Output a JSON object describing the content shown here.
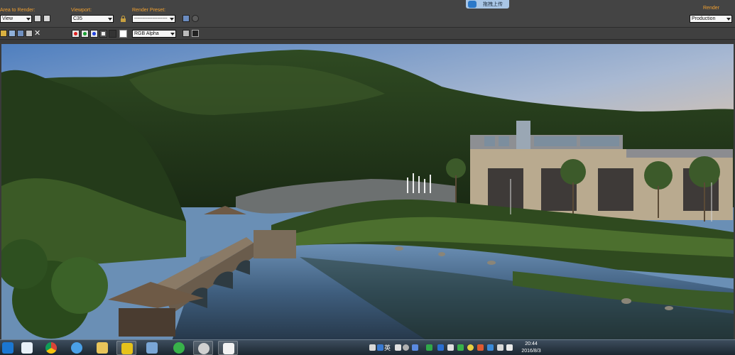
{
  "toolbar": {
    "area_label": "Area to Render:",
    "area_value": "View",
    "viewport_label": "Viewport:",
    "viewport_value": "C35",
    "preset_label": "Render Preset:",
    "preset_value": "--------------------",
    "render_label": "Render",
    "render_mode": "Production",
    "channel_value": "RGB Alpha"
  },
  "upload": {
    "label": "拖拽上传",
    "icon": "cloud-upload-icon"
  },
  "channels": {
    "red": "#e02020",
    "green": "#18a030",
    "blue": "#2040e0"
  },
  "ime": {
    "lang": "英"
  },
  "clock": {
    "time": "20:44",
    "date": "2016/8/3"
  },
  "taskbar": {
    "apps": [
      "start-icon",
      "app-icon",
      "chrome-icon",
      "baidu-cloud-icon",
      "file-explorer-icon",
      "photoshop-icon",
      "window-icon",
      "360-icon",
      "gimp-icon",
      "3dsmax-icon"
    ]
  }
}
